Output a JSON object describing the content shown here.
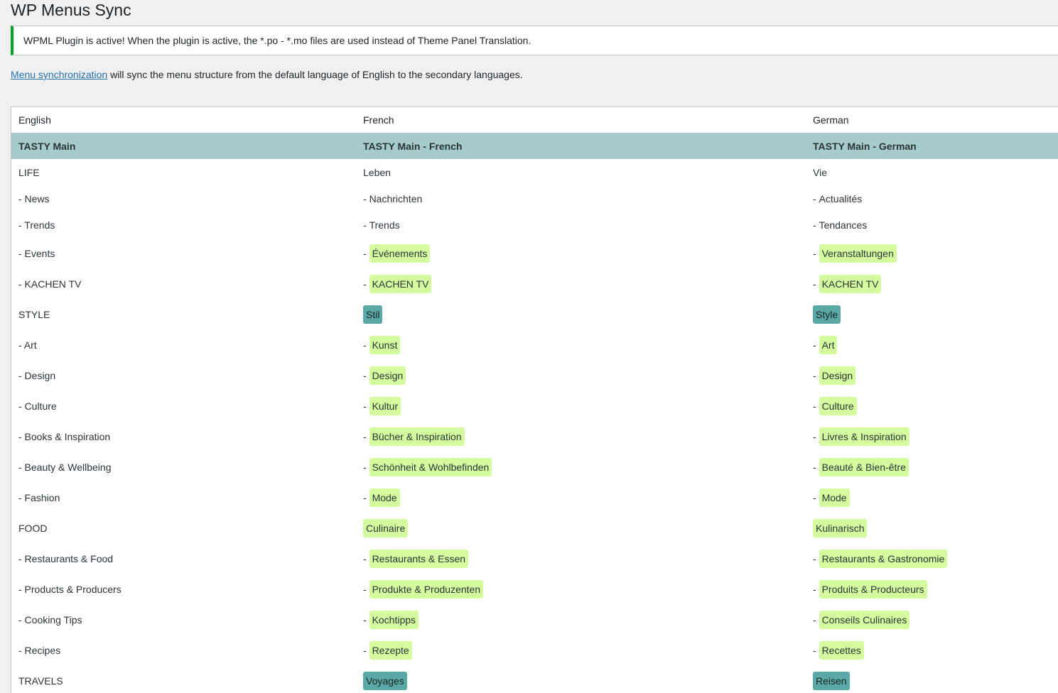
{
  "page_title": "WP Menus Sync",
  "notice": {
    "text": "WPML Plugin is active! When the plugin is active, the *.po - *.mo files are used instead of Theme Panel Translation.",
    "color": "#00a32a"
  },
  "intro": {
    "link_text": "Menu synchronization",
    "rest_text": " will sync the menu structure from the default language of English to the secondary languages."
  },
  "table": {
    "headers": [
      "English",
      "French",
      "German"
    ],
    "menu_names": [
      "TASTY Main",
      "TASTY Main - French",
      "TASTY Main - German"
    ],
    "colors": {
      "menu_row": "#a5cbcb",
      "new_item_highlight": "#d4fc9f",
      "new_top_item_highlight": "#5aa9a6"
    },
    "rows": [
      {
        "en": "LIFE",
        "fr": "Leben",
        "de": "Vie",
        "child": false,
        "new": false
      },
      {
        "en": "- News",
        "fr": "Nachrichten",
        "de": "Actualités",
        "child": true,
        "new": false
      },
      {
        "en": "- Trends",
        "fr": "Trends",
        "de": "Tendances",
        "child": true,
        "new": false
      },
      {
        "en": "- Events",
        "fr": "Événements",
        "de": "Veranstaltungen",
        "child": true,
        "new": true
      },
      {
        "en": "- KACHEN TV",
        "fr": "KACHEN TV",
        "de": "KACHEN TV",
        "child": true,
        "new": true
      },
      {
        "en": "STYLE",
        "fr": "Stil",
        "de": "Style",
        "child": false,
        "new": true
      },
      {
        "en": "- Art",
        "fr": "Kunst",
        "de": "Art",
        "child": true,
        "new": true
      },
      {
        "en": "- Design",
        "fr": "Design",
        "de": "Design",
        "child": true,
        "new": true
      },
      {
        "en": "- Culture",
        "fr": "Kultur",
        "de": "Culture",
        "child": true,
        "new": true
      },
      {
        "en": "- Books & Inspiration",
        "fr": "Bücher & Inspiration",
        "de": "Livres & Inspiration",
        "child": true,
        "new": true
      },
      {
        "en": "- Beauty & Wellbeing",
        "fr": "Schönheit & Wohlbefinden",
        "de": "Beauté & Bien-être",
        "child": true,
        "new": true
      },
      {
        "en": "- Fashion",
        "fr": "Mode",
        "de": "Mode",
        "child": true,
        "new": true
      },
      {
        "en": "FOOD",
        "fr": "Culinaire",
        "de": "Kulinarisch",
        "child": false,
        "new": true,
        "light": true
      },
      {
        "en": "- Restaurants & Food",
        "fr": "Restaurants & Essen",
        "de": "Restaurants & Gastronomie",
        "child": true,
        "new": true
      },
      {
        "en": "- Products & Producers",
        "fr": "Produkte & Produzenten",
        "de": "Produits & Producteurs",
        "child": true,
        "new": true
      },
      {
        "en": "- Cooking Tips",
        "fr": "Kochtipps",
        "de": "Conseils Culinaires",
        "child": true,
        "new": true
      },
      {
        "en": "- Recipes",
        "fr": "Rezepte",
        "de": "Recettes",
        "child": true,
        "new": true
      },
      {
        "en": "TRAVELS",
        "fr": "Voyages",
        "de": "Reisen",
        "child": false,
        "new": true
      }
    ]
  }
}
